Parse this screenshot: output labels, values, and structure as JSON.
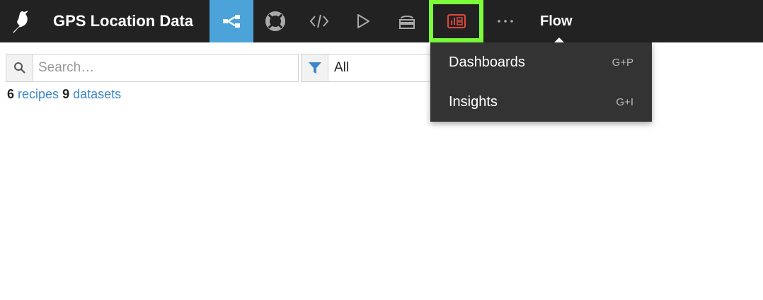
{
  "header": {
    "project_title": "GPS Location Data",
    "current_section": "Flow"
  },
  "search": {
    "placeholder": "Search…",
    "value": ""
  },
  "filter": {
    "value": "All"
  },
  "counts": {
    "recipes_count": "6",
    "recipes_label": "recipes",
    "datasets_count": "9",
    "datasets_label": "datasets"
  },
  "dropdown": {
    "items": [
      {
        "label": "Dashboards",
        "shortcut": "G+P"
      },
      {
        "label": "Insights",
        "shortcut": "G+I"
      }
    ]
  },
  "colors": {
    "topbar": "#222222",
    "active_nav": "#4ba3d9",
    "highlight_outline": "#7cff3a",
    "dashboard_icon": "#e0473f",
    "link": "#3a87c8"
  }
}
